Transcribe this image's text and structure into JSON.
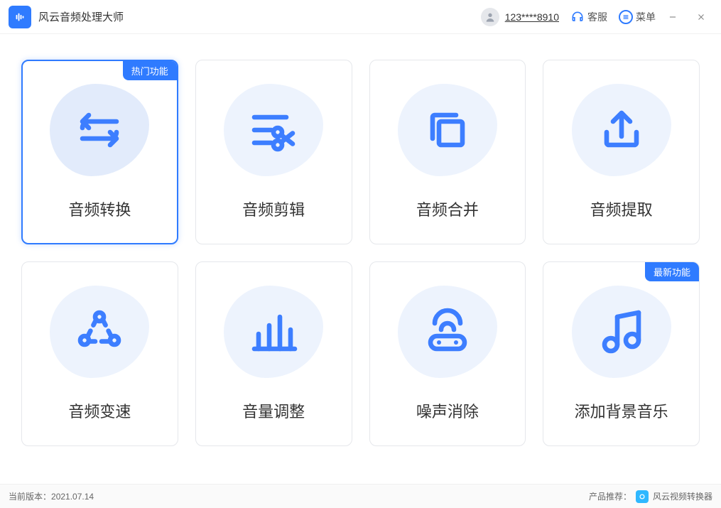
{
  "app": {
    "title": "风云音频处理大师"
  },
  "titlebar": {
    "phone": "123****8910",
    "service": "客服",
    "menu": "菜单"
  },
  "ribbons": {
    "hot": "热门功能",
    "new": "最新功能"
  },
  "cards": [
    {
      "label": "音频转换"
    },
    {
      "label": "音频剪辑"
    },
    {
      "label": "音频合并"
    },
    {
      "label": "音频提取"
    },
    {
      "label": "音频变速"
    },
    {
      "label": "音量调整"
    },
    {
      "label": "噪声消除"
    },
    {
      "label": "添加背景音乐"
    }
  ],
  "footer": {
    "version_label": "当前版本：",
    "version": "2021.07.14",
    "recommend_label": "产品推荐：",
    "recommend_product": "风云视频转换器"
  }
}
